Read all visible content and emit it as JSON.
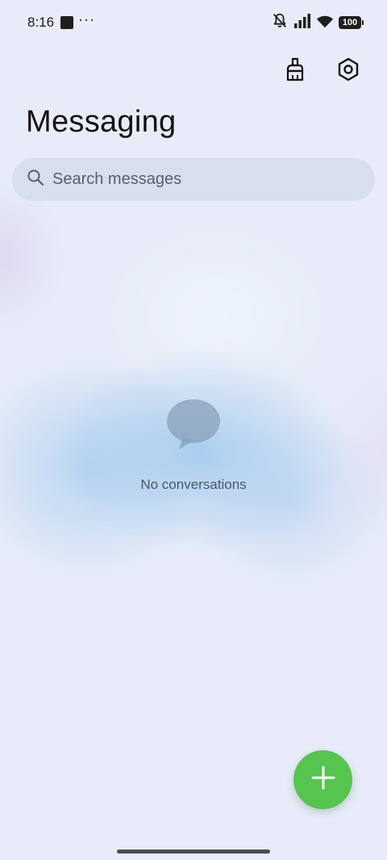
{
  "status_bar": {
    "time": "8:16",
    "more_indicator": "···",
    "battery_level": "100",
    "icons": [
      "muted-bell-icon",
      "signal-icon",
      "wifi-icon",
      "battery-icon"
    ]
  },
  "header": {
    "title": "Messaging",
    "actions": [
      {
        "name": "clean-brush-icon"
      },
      {
        "name": "settings-icon"
      }
    ]
  },
  "search": {
    "placeholder": "Search messages",
    "value": ""
  },
  "empty_state": {
    "icon": "chat-bubble-icon",
    "text": "No conversations"
  },
  "fab": {
    "icon": "plus-icon",
    "color": "#56c44f"
  },
  "colors": {
    "accent": "#56c44f",
    "background": "#e7ecf8"
  }
}
